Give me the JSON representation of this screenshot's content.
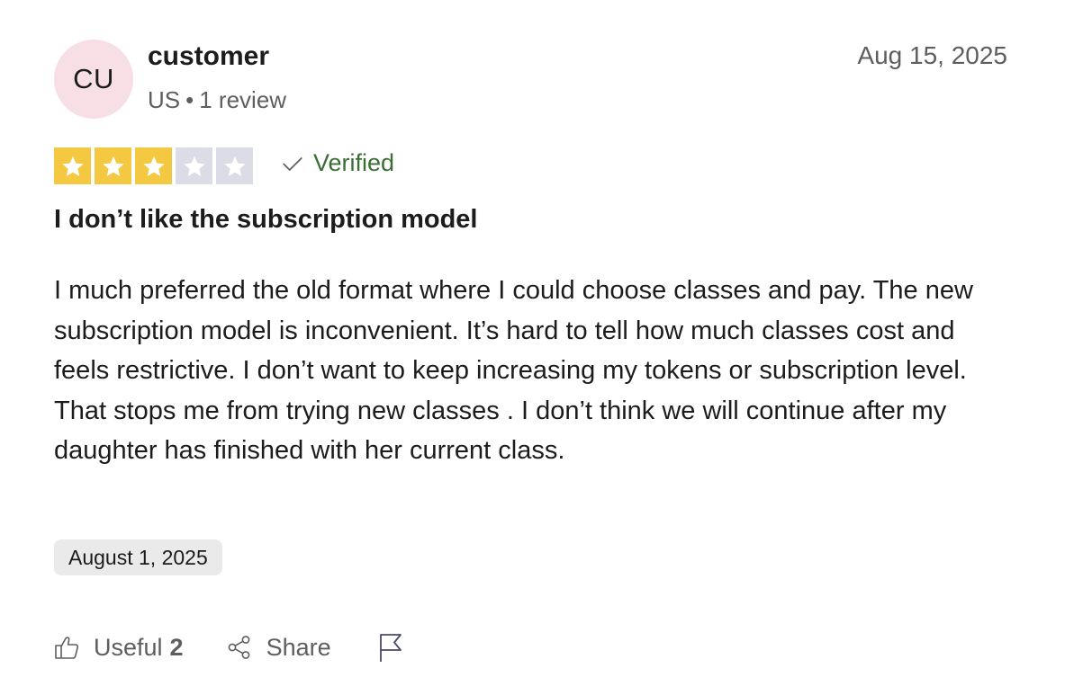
{
  "reviewer": {
    "initials": "CU",
    "name": "customer",
    "country": "US",
    "separator": "•",
    "review_count": "1 review",
    "avatar_color": "#f7dfe5"
  },
  "review": {
    "posted_date": "Aug 15, 2025",
    "rating": 3,
    "rating_max": 5,
    "star_on_color": "#f5c842",
    "star_off_color": "#dcdce6",
    "verified_label": "Verified",
    "verified_color": "#3b6e35",
    "title": "I don’t like the subscription model",
    "body": "I much preferred the old format where I could choose classes and pay. The new subscription model is inconvenient. It’s hard to tell how much classes cost and feels restrictive. I don’t want to keep increasing my tokens or subscription level. That stops me from trying new classes . I don’t think we will continue after my daughter has finished with her current class.",
    "experience_date": "August 1, 2025"
  },
  "actions": {
    "useful_label": "Useful",
    "useful_count": "2",
    "useful_icon": "thumbs-up-icon",
    "share_label": "Share",
    "share_icon": "share-icon",
    "report_icon": "flag-icon"
  }
}
